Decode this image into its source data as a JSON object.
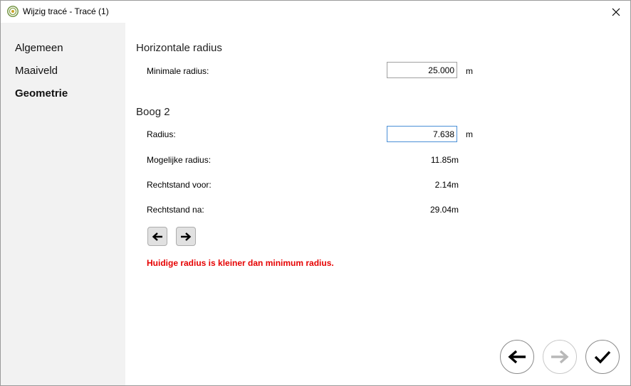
{
  "window": {
    "title": "Wijzig tracé - Tracé (1)"
  },
  "sidebar": {
    "items": [
      {
        "label": "Algemeen",
        "active": false
      },
      {
        "label": "Maaiveld",
        "active": false
      },
      {
        "label": "Geometrie",
        "active": true
      }
    ]
  },
  "horizontal": {
    "title": "Horizontale radius",
    "min_radius_label": "Minimale radius:",
    "min_radius_value": "25.000",
    "unit": "m"
  },
  "boog": {
    "title": "Boog 2",
    "radius_label": "Radius:",
    "radius_value": "7.638",
    "unit": "m",
    "possible_label": "Mogelijke radius:",
    "possible_value": "11.85m",
    "before_label": "Rechtstand voor:",
    "before_value": "2.14m",
    "after_label": "Rechtstand na:",
    "after_value": "29.04m"
  },
  "error_message": "Huidige radius is kleiner dan minimum radius.",
  "colors": {
    "error": "#e60000",
    "sidebar_bg": "#f2f2f2",
    "focus_border": "#4a8fd6"
  },
  "icons": {
    "app": "trace-app-icon",
    "close": "close-icon",
    "prev_boog": "arrow-left-icon",
    "next_boog": "arrow-right-icon",
    "back": "arrow-left-icon",
    "forward": "arrow-right-icon",
    "confirm": "checkmark-icon"
  }
}
